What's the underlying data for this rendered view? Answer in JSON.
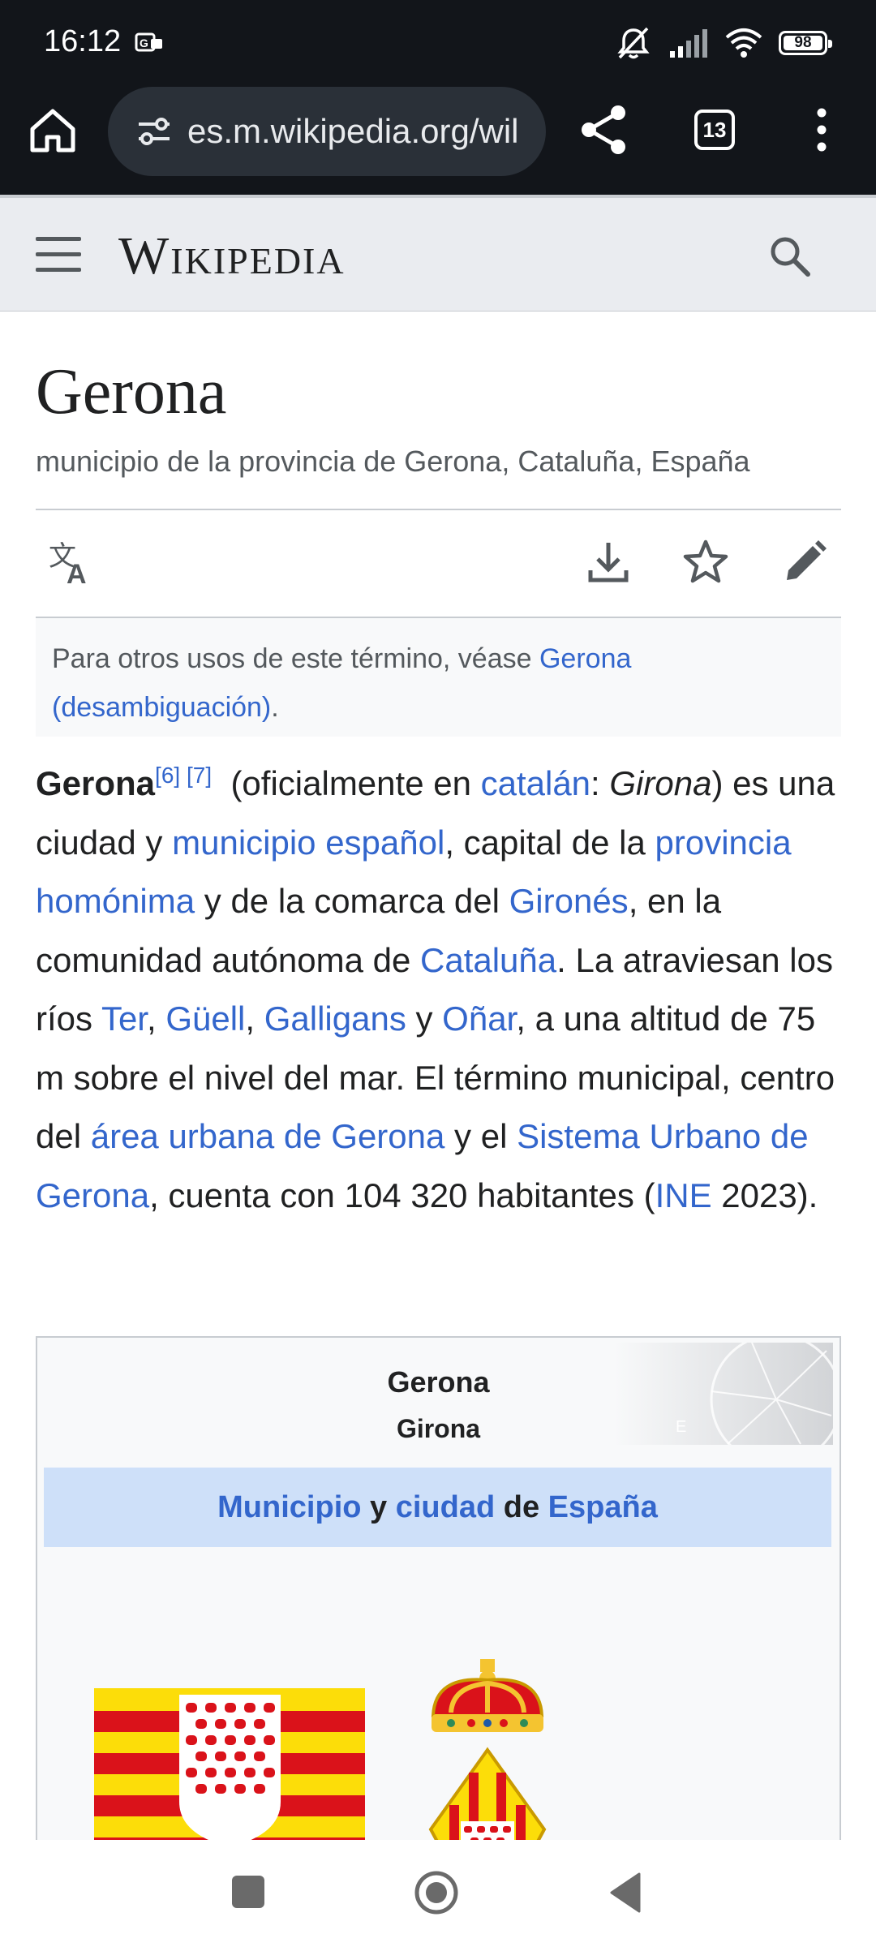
{
  "status_bar": {
    "time": "16:12",
    "battery": "98",
    "icons": [
      "message-icon",
      "mute-icon",
      "signal-icon",
      "wifi-icon",
      "battery-icon"
    ]
  },
  "browser": {
    "url": "es.m.wikipedia.org/wil",
    "tab_count": "13",
    "icons": [
      "home-icon",
      "tune-icon",
      "share-icon",
      "tabs-icon",
      "more-vert-icon"
    ]
  },
  "wiki_header": {
    "logo": "Wikipedia",
    "icons": [
      "menu-icon",
      "search-icon"
    ]
  },
  "article": {
    "title": "Gerona",
    "subtitle": "municipio de la provincia de Gerona, Cataluña, España",
    "action_icons": [
      "translate-icon",
      "download-icon",
      "star-icon",
      "edit-icon"
    ],
    "hatnote": {
      "prefix": "Para otros usos de este término, véase ",
      "link": "Gerona (desambiguación)",
      "suffix": "."
    },
    "intro": {
      "term": "Gerona",
      "ref1": "[6]",
      "ref2": "[7]",
      "t1": " (oficialmente en ",
      "l_catalan": "catalán",
      "t2": ": ",
      "t_girona": "Girona",
      "t3": ") es una ciudad y ",
      "l_municipio": "municipio español",
      "t4": ", capital de la ",
      "l_provincia": "provincia homónima",
      "t5": " y de la comarca del ",
      "l_girones": "Gironés",
      "t6": ", en la comunidad autónoma de ",
      "l_cataluna": "Cataluña",
      "t7": ". La atraviesan los ríos ",
      "l_ter": "Ter",
      "c1": ", ",
      "l_guell": "Güell",
      "c2": ", ",
      "l_galligans": "Galligans",
      "t8": " y ",
      "l_onar": "Oñar",
      "t9": ", a una altitud de 75 m sobre el nivel del mar. El término municipal, centro del ",
      "l_area": "área urbana de Gerona",
      "t10": " y el ",
      "l_sistema": "Sistema Urbano de Gerona",
      "t11": ", cuenta con 104 320 habitantes (",
      "l_ine": "INE",
      "t12": " 2023)."
    }
  },
  "infobox": {
    "title": "Gerona",
    "subtitle": "Girona",
    "type_l1": "Municipio",
    "type_t1": " y ",
    "type_l2": "ciudad",
    "type_t2": " de ",
    "type_l3": "España",
    "images": [
      "flag-image",
      "coat-of-arms-image"
    ],
    "colors": {
      "header_bg": "#cee0f9",
      "flag_yellow": "#fcdd09",
      "flag_red": "#da121a"
    }
  },
  "nav_bar": {
    "icons": [
      "recents-icon",
      "home-circle-icon",
      "back-icon"
    ]
  }
}
